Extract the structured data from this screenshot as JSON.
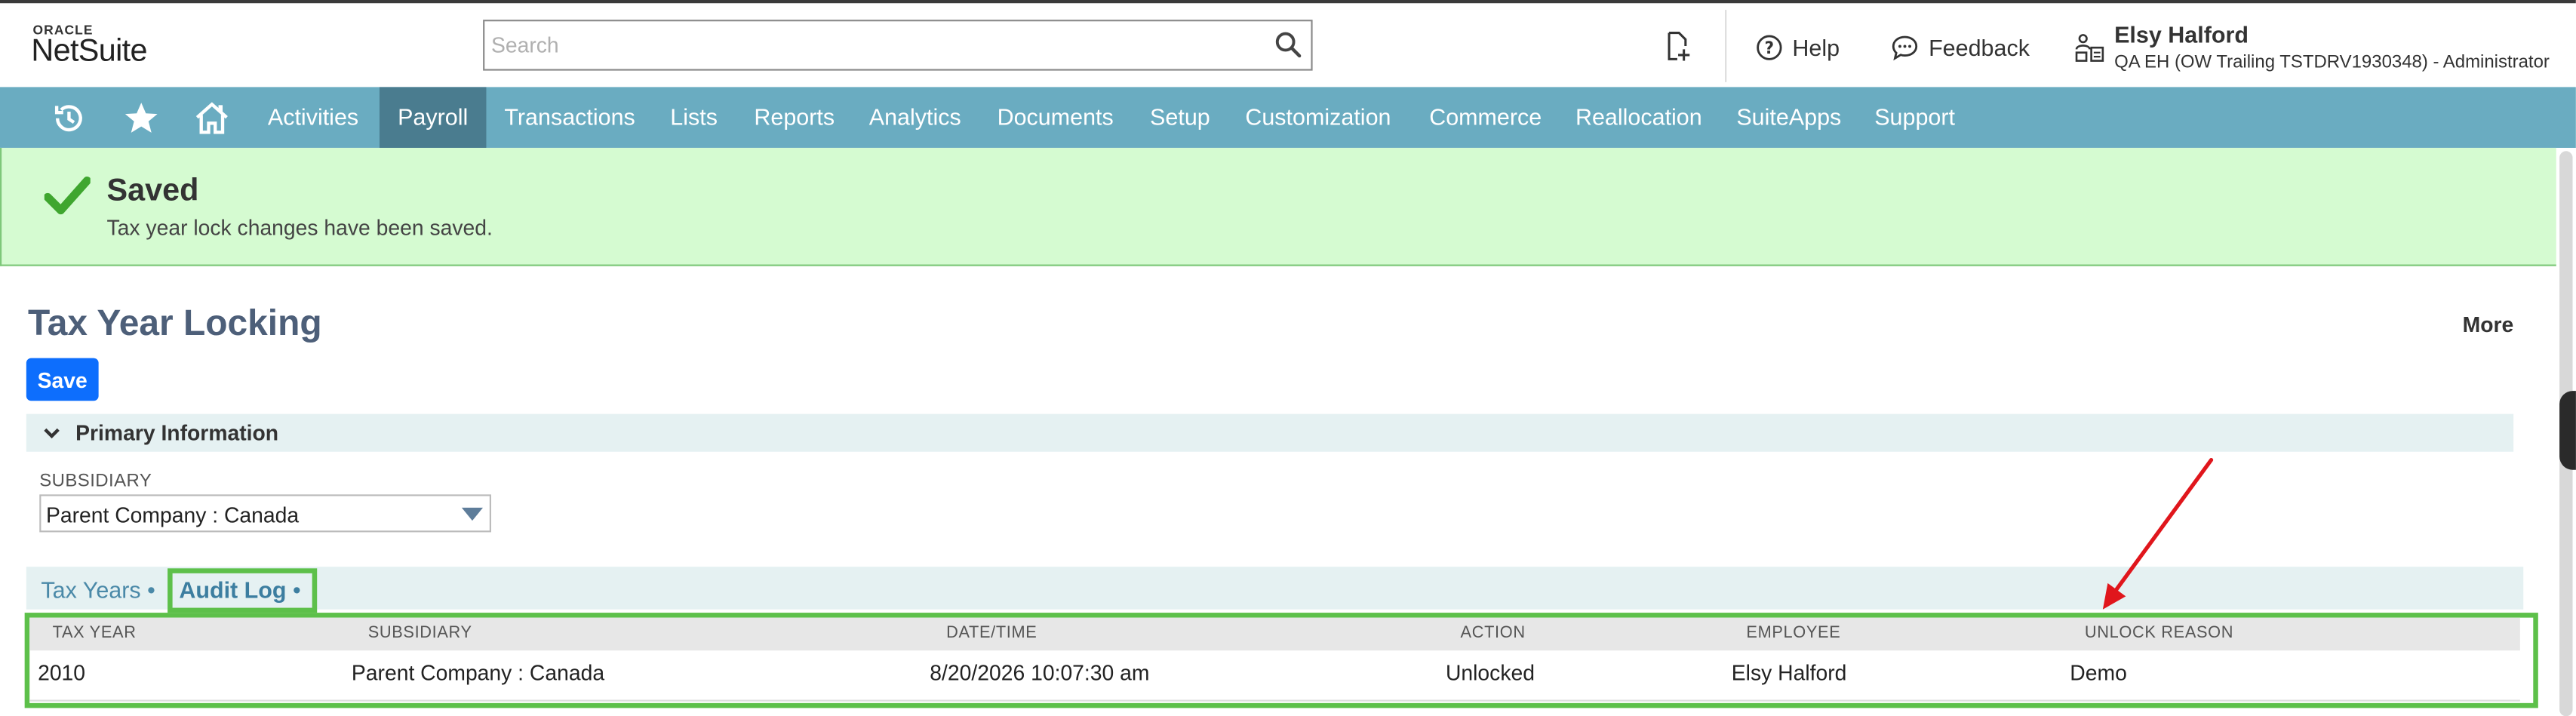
{
  "header": {
    "logo_top": "ORACLE",
    "logo_main": "NetSuite",
    "search_placeholder": "Search",
    "help_label": "Help",
    "feedback_label": "Feedback",
    "user_name": "Elsy Halford",
    "user_role": "QA EH (OW Trailing TSTDRV1930348) - Administrator"
  },
  "nav": {
    "items": [
      "Activities",
      "Payroll",
      "Transactions",
      "Lists",
      "Reports",
      "Analytics",
      "Documents",
      "Setup",
      "Customization",
      "Commerce",
      "Reallocation",
      "SuiteApps",
      "Support"
    ],
    "active": "Payroll"
  },
  "banner": {
    "title": "Saved",
    "message": "Tax year lock changes have been saved."
  },
  "page": {
    "title": "Tax Year Locking",
    "more_label": "More",
    "save_label": "Save",
    "section_title": "Primary Information",
    "subsidiary_label": "SUBSIDIARY",
    "subsidiary_value": "Parent Company : Canada"
  },
  "tabs": {
    "tax_years": "Tax Years",
    "audit_log": "Audit Log",
    "dot": "•"
  },
  "audit_table": {
    "headers": [
      "TAX YEAR",
      "SUBSIDIARY",
      "DATE/TIME",
      "ACTION",
      "EMPLOYEE",
      "UNLOCK REASON"
    ],
    "rows": [
      [
        "2010",
        "Parent Company : Canada",
        "8/20/2026 10:07:30 am",
        "Unlocked",
        "Elsy Halford",
        "Demo"
      ]
    ]
  },
  "colors": {
    "nav_bg": "#6aacc1",
    "nav_active": "#4a7c8f",
    "banner_bg": "#d5fbd1",
    "save_button": "#0d6efd",
    "highlight_border": "#5dc04a",
    "annotation_arrow": "#e0161c"
  }
}
